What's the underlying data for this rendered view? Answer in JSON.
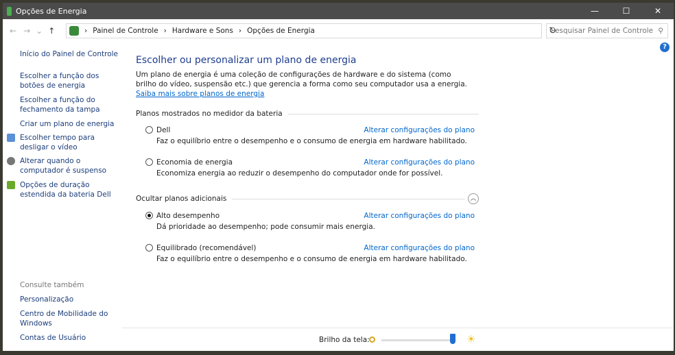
{
  "window": {
    "title": "Opções de Energia",
    "minimize": "—",
    "maximize": "☐",
    "close": "✕"
  },
  "address": {
    "back": "←",
    "forward": "→",
    "recent": "⌄",
    "up": "↑",
    "crumbs": [
      "Painel de Controle",
      "Hardware e Sons",
      "Opções de Energia"
    ],
    "refresh": "↻",
    "search_placeholder": "Pesquisar Painel de Controle"
  },
  "sidebar": {
    "home": "Início do Painel de Controle",
    "items": [
      "Escolher a função dos botões de energia",
      "Escolher a função do fechamento da tampa",
      "Criar um plano de energia",
      "Escolher tempo para desligar o vídeo",
      "Alterar quando o computador é suspenso",
      "Opções de duração estendida da bateria Dell"
    ],
    "see_also": "Consulte também",
    "see_also_items": [
      "Personalização",
      "Centro de Mobilidade do Windows",
      "Contas de Usuário"
    ]
  },
  "main": {
    "title": "Escolher ou personalizar um plano de energia",
    "description": "Um plano de energia é uma coleção de configurações de hardware e do sistema (como brilho do vídeo, suspensão etc.) que gerencia a forma como seu computador usa a energia.",
    "learn_more": "Saiba mais sobre planos de energia",
    "section1": "Planos mostrados no medidor da bateria",
    "section2": "Ocultar planos adicionais",
    "change_label": "Alterar configurações do plano",
    "plans": [
      {
        "name": "Dell",
        "desc": "Faz o equilíbrio entre o desempenho e o consumo de energia em hardware habilitado.",
        "selected": false
      },
      {
        "name": "Economia de energia",
        "desc": "Economiza energia ao reduzir o desempenho do computador onde for possível.",
        "selected": false
      },
      {
        "name": "Alto desempenho",
        "desc": "Dá prioridade ao desempenho; pode consumir mais energia.",
        "selected": true
      },
      {
        "name": "Equilibrado (recomendável)",
        "desc": "Faz o equilíbrio entre o desempenho e o consumo de energia em hardware habilitado.",
        "selected": false
      }
    ]
  },
  "brightness": {
    "label": "Brilho da tela:",
    "value_percent": 100
  },
  "help": "?"
}
